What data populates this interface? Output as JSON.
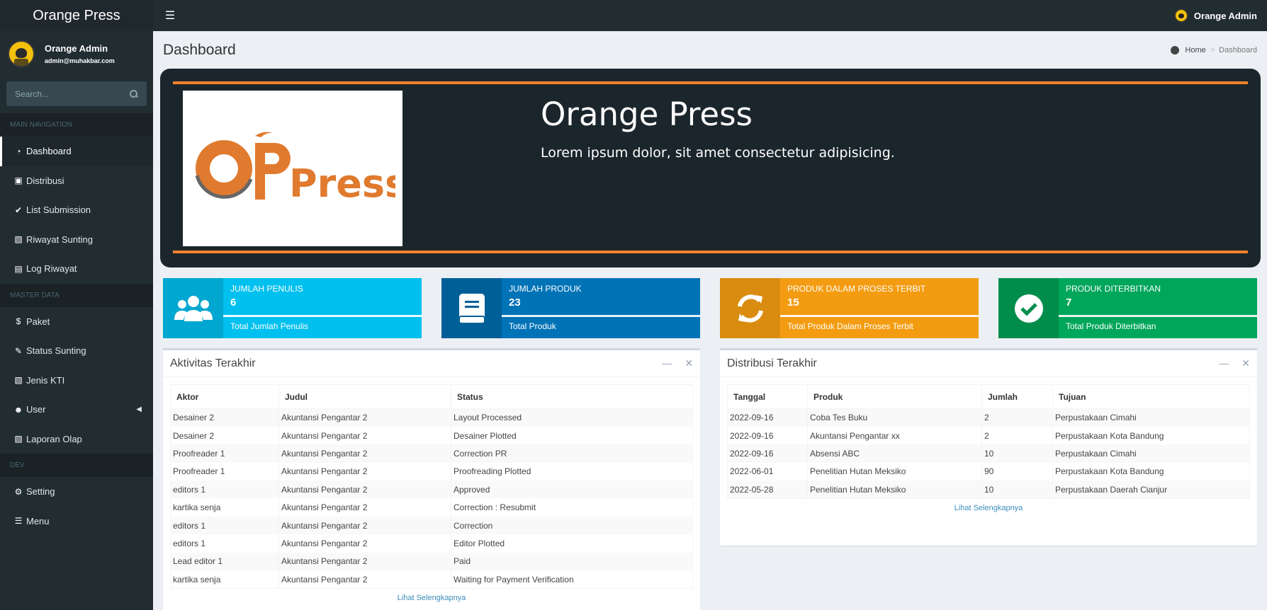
{
  "app": {
    "brand": "Orange Press"
  },
  "topbar": {
    "user_name": "Orange Admin"
  },
  "user_panel": {
    "name": "Orange Admin",
    "email": "admin@muhakbar.com"
  },
  "search": {
    "placeholder": "Search..."
  },
  "sidebar": {
    "sections": {
      "main": "MAIN NAVIGATION",
      "master": "MASTER DATA",
      "dev": "DEV"
    },
    "items": [
      {
        "label": "Dashboard",
        "icon": "dashboard-icon"
      },
      {
        "label": "Distribusi",
        "icon": "cubes-icon"
      },
      {
        "label": "List Submission",
        "icon": "check-double-icon"
      },
      {
        "label": "Riwayat Sunting",
        "icon": "book-icon"
      },
      {
        "label": "Log Riwayat",
        "icon": "clipboard-icon"
      },
      {
        "label": "Paket",
        "icon": "dollar-icon"
      },
      {
        "label": "Status Sunting",
        "icon": "edit-icon"
      },
      {
        "label": "Jenis KTI",
        "icon": "book-icon"
      },
      {
        "label": "User",
        "icon": "users-icon"
      },
      {
        "label": "Laporan Olap",
        "icon": "book-icon"
      },
      {
        "label": "Setting",
        "icon": "gear-icon"
      },
      {
        "label": "Menu",
        "icon": "bars-icon"
      }
    ]
  },
  "header": {
    "title": "Dashboard",
    "breadcrumb_home": "Home",
    "breadcrumb_current": "Dashboard"
  },
  "hero": {
    "title": "Orange Press",
    "subtitle": "Lorem ipsum dolor, sit amet consectetur adipisicing.",
    "logo_text_o": "O",
    "logo_text_press": "Press",
    "accent": "#f2822b"
  },
  "stats": [
    {
      "label": "JUMLAH PENULIS",
      "value": "6",
      "desc": "Total Jumlah Penulis",
      "icon": "users-icon",
      "color": "#00c0ef"
    },
    {
      "label": "JUMLAH PRODUK",
      "value": "23",
      "desc": "Total Produk",
      "icon": "book-icon",
      "color": "#0073b7"
    },
    {
      "label": "PRODUK DALAM PROSES TERBIT",
      "value": "15",
      "desc": "Total Produk Dalam Proses Terbit",
      "icon": "sync-icon",
      "color": "#f39c12"
    },
    {
      "label": "PRODUK DITERBITKAN",
      "value": "7",
      "desc": "Total Produk Diterbitkan",
      "icon": "check-circle-icon",
      "color": "#00a65a"
    }
  ],
  "activity": {
    "title": "Aktivitas Terakhir",
    "headers": [
      "Aktor",
      "Judul",
      "Status"
    ],
    "rows": [
      [
        "Desainer 2",
        "Akuntansi Pengantar 2",
        "Layout Processed"
      ],
      [
        "Desainer 2",
        "Akuntansi Pengantar 2",
        "Desainer Plotted"
      ],
      [
        "Proofreader 1",
        "Akuntansi Pengantar 2",
        "Correction PR"
      ],
      [
        "Proofreader 1",
        "Akuntansi Pengantar 2",
        "Proofreading Plotted"
      ],
      [
        "editors 1",
        "Akuntansi Pengantar 2",
        "Approved"
      ],
      [
        "kartika senja",
        "Akuntansi Pengantar 2",
        "Correction : Resubmit"
      ],
      [
        "editors 1",
        "Akuntansi Pengantar 2",
        "Correction"
      ],
      [
        "editors 1",
        "Akuntansi Pengantar 2",
        "Editor Plotted"
      ],
      [
        "Lead editor 1",
        "Akuntansi Pengantar 2",
        "Paid"
      ],
      [
        "kartika senja",
        "Akuntansi Pengantar 2",
        "Waiting for Payment Verification"
      ]
    ],
    "more": "Lihat Selengkapnya"
  },
  "distribution": {
    "title": "Distribusi Terakhir",
    "headers": [
      "Tanggal",
      "Produk",
      "Jumlah",
      "Tujuan"
    ],
    "rows": [
      [
        "2022-09-16",
        "Coba Tes Buku",
        "2",
        "Perpustakaan Cimahi"
      ],
      [
        "2022-09-16",
        "Akuntansi Pengantar xx",
        "2",
        "Perpustakaan Kota Bandung"
      ],
      [
        "2022-09-16",
        "Absensi ABC",
        "10",
        "Perpustakaan Cimahi"
      ],
      [
        "2022-06-01",
        "Penelitian Hutan Meksiko",
        "90",
        "Perpustakaan Kota Bandung"
      ],
      [
        "2022-05-28",
        "Penelitian Hutan Meksiko",
        "10",
        "Perpustakaan Daerah Cianjur"
      ]
    ],
    "more": "Lihat Selengkapnya"
  }
}
